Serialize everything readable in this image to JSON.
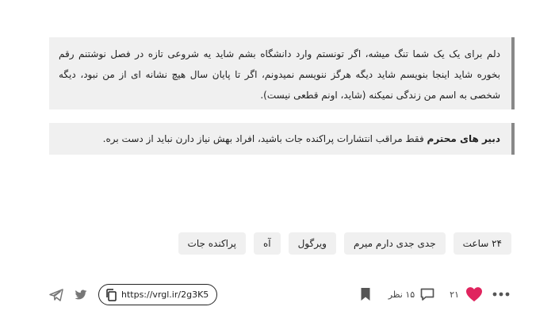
{
  "post": {
    "quote1_text": "دلم برای یک یک شما تنگ میشه، اگر تونستم وارد دانشگاه بشم شاید یه شروعی تازه در فصل نوشتنم رقم بخوره شاید اینجا بنویسم شاید دیگه هرگز ننویسم نمیدونم، اگر تا پایان سال هیچ نشانه ای از من نبود، دیگه شخصی به اسم من زندگی نمیکنه (شاید، اونم قطعی نیست).",
    "quote2_bold": "دبیر های محترم",
    "quote2_text": " فقط مراقب انتشارات پراکنده جات باشید، افراد بهش نیاز دارن نباید از دست بره."
  },
  "tags": [
    "۲۴ ساعت",
    "جدی جدی دارم میرم",
    "ویرگول",
    "آه",
    "پراکنده جات"
  ],
  "actions": {
    "likes_count": "۲۱",
    "comments_count": "۱۵ نظر",
    "short_link": "https://vrgl.ir/2g3K5"
  },
  "colors": {
    "heart": "#e0245e",
    "quote_bg": "#f0f0f0",
    "quote_border": "#888888",
    "icon_gray": "#777777"
  },
  "icons": {
    "more": "more-dots-icon",
    "like": "heart-icon",
    "comment": "comment-bubble-icon",
    "bookmark": "bookmark-icon",
    "telegram": "telegram-icon",
    "twitter": "twitter-icon",
    "copy": "copy-icon"
  }
}
